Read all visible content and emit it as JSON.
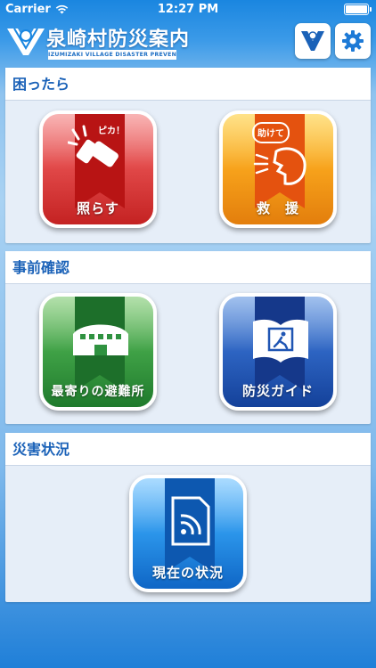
{
  "status_bar": {
    "carrier": "Carrier",
    "time": "12:27 PM"
  },
  "header": {
    "title": "泉崎村防災案内",
    "subtitle": "IZUMIZAKI VILLAGE DISASTER PREVENTION GUIDE",
    "emblem_icon": "village-emblem-icon",
    "settings_icon": "gear-icon"
  },
  "sections": [
    {
      "title": "困ったら",
      "tiles": [
        {
          "label": "照らす",
          "icon": "flashlight-icon",
          "bubble": "ピカ！",
          "color": "#d93a3a"
        },
        {
          "label": "救　援",
          "icon": "shout-for-help-icon",
          "bubble": "助けて",
          "color": "#f39a1a"
        }
      ]
    },
    {
      "title": "事前確認",
      "tiles": [
        {
          "label": "最寄りの避難所",
          "icon": "shelter-building-icon",
          "color": "#2f9240"
        },
        {
          "label": "防災ガイド",
          "icon": "guide-book-icon",
          "color": "#1f55b3"
        }
      ]
    },
    {
      "title": "災害状況",
      "tiles": [
        {
          "label": "現在の状況",
          "icon": "live-feed-icon",
          "color": "#1d84e0"
        }
      ]
    }
  ]
}
